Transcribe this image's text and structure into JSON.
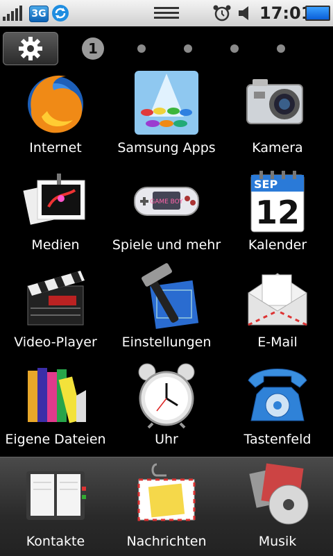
{
  "status_bar": {
    "network": "3G",
    "time": "17:01"
  },
  "home": {
    "page_indicator": "1"
  },
  "apps": [
    {
      "label": "Internet"
    },
    {
      "label": "Samsung Apps"
    },
    {
      "label": "Kamera"
    },
    {
      "label": "Medien"
    },
    {
      "label": "Spiele und mehr"
    },
    {
      "label": "Kalender",
      "calendar_month": "SEP",
      "calendar_day": "12"
    },
    {
      "label": "Video-Player"
    },
    {
      "label": "Einstellungen"
    },
    {
      "label": "E-Mail"
    },
    {
      "label": "Eigene Dateien"
    },
    {
      "label": "Uhr"
    },
    {
      "label": "Tastenfeld"
    }
  ],
  "dock": [
    {
      "label": "Kontakte"
    },
    {
      "label": "Nachrichten"
    },
    {
      "label": "Musik"
    }
  ],
  "colors": {
    "background": "#000000",
    "status_bar": "#e0e0e0",
    "battery": "#1a7cf0",
    "accent_blue": "#2a8be0"
  }
}
